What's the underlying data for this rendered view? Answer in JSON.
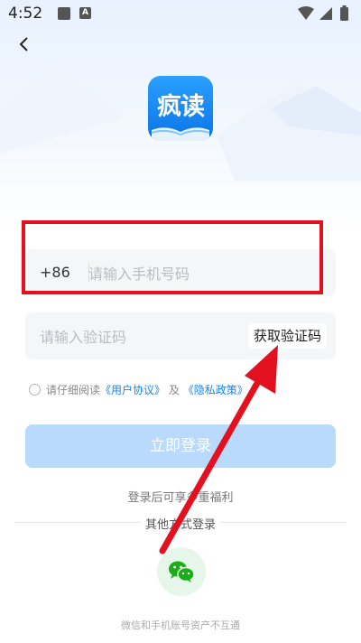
{
  "status_bar": {
    "time": "4:52",
    "notif_icon_letter": "A"
  },
  "header": {
    "back_icon": "chevron-left-icon"
  },
  "app_logo": {
    "text": "疯读"
  },
  "phone_field": {
    "country_code": "+86",
    "placeholder": "请输入手机号码",
    "value": ""
  },
  "code_field": {
    "placeholder": "请输入验证码",
    "value": "",
    "get_code_label": "获取验证码"
  },
  "agreement": {
    "prefix": "请仔细阅读",
    "user_agreement": "《用户协议》",
    "and": "及",
    "privacy_policy": "《隐私政策》"
  },
  "login_button": {
    "label": "立即登录"
  },
  "perk_text": "登录后可享多重福利",
  "other_login": {
    "label": "其他方式登录",
    "wechat_icon": "wechat-icon"
  },
  "notice": "微信和手机账号资产不互通",
  "colors": {
    "accent": "#1a82f0",
    "button_disabled": "#b9dafc",
    "highlight": "#e3101f",
    "wechat_green": "#1aad19"
  }
}
